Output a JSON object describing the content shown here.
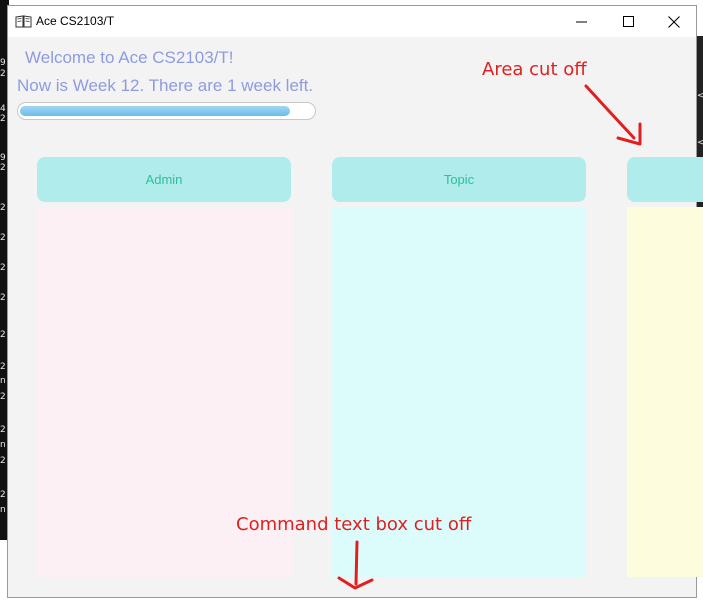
{
  "window": {
    "title": "Ace CS2103/T",
    "controls": [
      "minimize",
      "maximize",
      "close"
    ]
  },
  "header": {
    "welcome": "Welcome to Ace CS2103/T!",
    "week_status": "Now is Week 12. There are 1 week left.",
    "progress": 0.92
  },
  "columns": [
    {
      "label": "Admin",
      "color": "#fdf0f4"
    },
    {
      "label": "Topic",
      "color": "#dcfcfc"
    },
    {
      "label": "",
      "color": "#fdfdde"
    }
  ],
  "annotations": {
    "area_cut_off": "Area cut off",
    "command_cut_off": "Command text box cut off"
  },
  "colors": {
    "header_bg": "#afeceb",
    "header_text": "#2fbf9a",
    "title_text": "#8f9be0",
    "annotation": "#e02020"
  }
}
